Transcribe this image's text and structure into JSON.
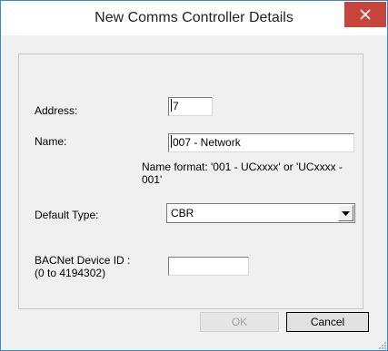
{
  "window": {
    "title": "New Comms Controller Details",
    "close_label": "×"
  },
  "form": {
    "address_label": "Address:",
    "address_value": "7",
    "name_label": "Name:",
    "name_value": "007 - Network",
    "name_hint": "Name format: '001 - UCxxxx' or 'UCxxxx - 001'",
    "default_type_label": "Default Type:",
    "default_type_value": "CBR",
    "bacnet_label_line1": "BACNet Device ID :",
    "bacnet_label_line2": "(0 to 4194302)",
    "bacnet_value": ""
  },
  "buttons": {
    "ok_label": "OK",
    "cancel_label": "Cancel",
    "ok_enabled": false
  },
  "colors": {
    "close_button": "#c7453b",
    "window_border": "#3c86c9",
    "dialog_background": "#f0f0f0"
  },
  "icons": [
    "close-icon",
    "chevron-down-icon",
    "resize-grip-icon"
  ]
}
